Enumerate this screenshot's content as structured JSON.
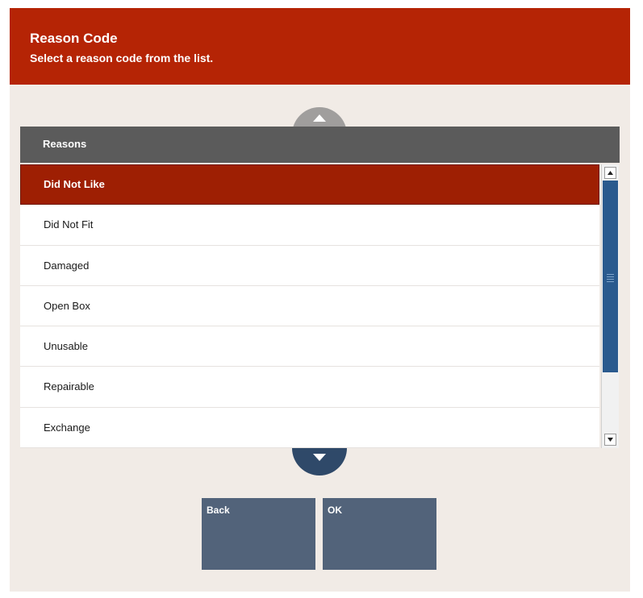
{
  "header": {
    "title": "Reason Code",
    "subtitle": "Select a reason code from the list."
  },
  "list": {
    "column_header": "Reasons",
    "items": [
      {
        "label": "Did Not Like",
        "selected": true
      },
      {
        "label": "Did Not Fit",
        "selected": false
      },
      {
        "label": "Damaged",
        "selected": false
      },
      {
        "label": "Open Box",
        "selected": false
      },
      {
        "label": "Unusable",
        "selected": false
      },
      {
        "label": "Repairable",
        "selected": false
      },
      {
        "label": "Exchange",
        "selected": false
      }
    ]
  },
  "buttons": {
    "back": "Back",
    "ok": "OK"
  },
  "icons": {
    "scroll_up": "triangle-up-icon",
    "scroll_down": "triangle-down-icon"
  },
  "colors": {
    "header_bg": "#b52405",
    "selected_row": "#9e1f03",
    "list_header_bg": "#5b5b5b",
    "button_bg": "#52637a",
    "scroll_up_bg": "#a09e9d",
    "scroll_down_bg": "#2f4969",
    "scrollbar_thumb": "#2a5a8e",
    "dialog_bg": "#f1ebe6"
  }
}
